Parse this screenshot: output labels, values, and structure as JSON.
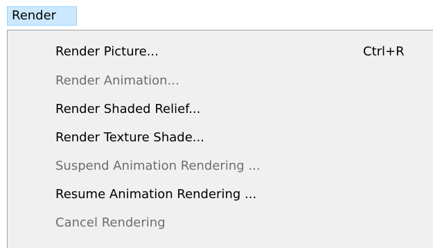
{
  "menubar": {
    "menu_title": "Render"
  },
  "menu": {
    "items": [
      {
        "label": "Render Picture...",
        "shortcut": "Ctrl+R",
        "enabled": true
      },
      {
        "label": "Render Animation...",
        "shortcut": "",
        "enabled": false
      },
      {
        "label": "Render Shaded Relief...",
        "shortcut": "",
        "enabled": true
      },
      {
        "label": "Render Texture Shade...",
        "shortcut": "",
        "enabled": true
      },
      {
        "label": "Suspend Animation Rendering ...",
        "shortcut": "",
        "enabled": false
      },
      {
        "label": "Resume Animation Rendering ...",
        "shortcut": "",
        "enabled": true
      },
      {
        "label": "Cancel Rendering",
        "shortcut": "",
        "enabled": false
      }
    ]
  },
  "colors": {
    "menubar_highlight": "#cce8ff",
    "menubar_highlight_border": "#99d1ff",
    "menu_background": "#f0f0f0",
    "menu_border": "#a0a0a0",
    "enabled_text": "#000000",
    "disabled_text": "#6d6d6d"
  }
}
